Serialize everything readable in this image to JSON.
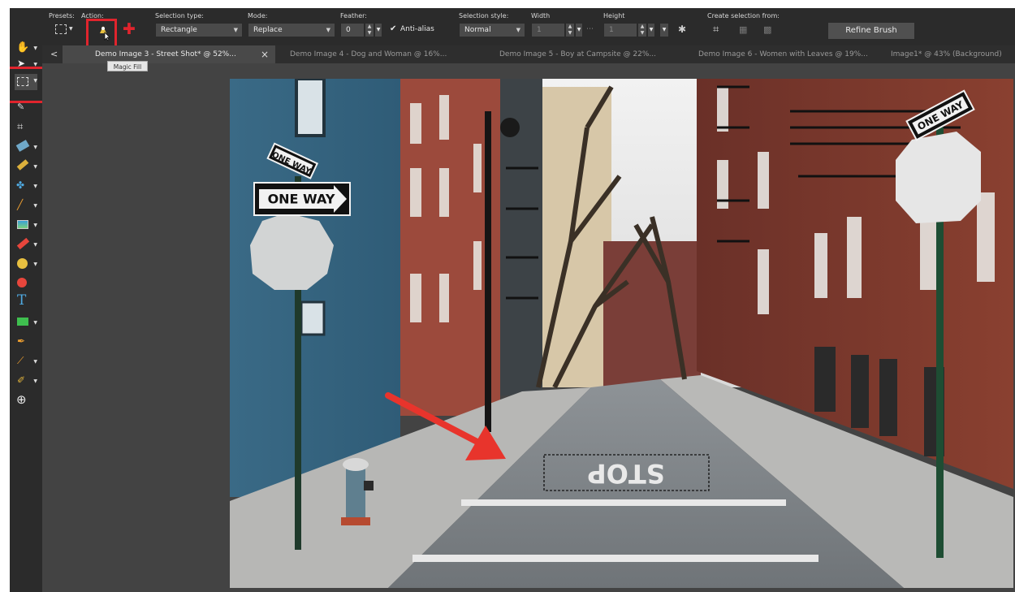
{
  "toolbar": {
    "presets_label": "Presets:",
    "action_label": "Action:",
    "selection_type_label": "Selection type:",
    "selection_type_value": "Rectangle",
    "mode_label": "Mode:",
    "mode_value": "Replace",
    "feather_label": "Feather:",
    "feather_value": "0",
    "antialias_label": "Anti-alias",
    "antialias_checked": true,
    "selection_style_label": "Selection style:",
    "selection_style_value": "Normal",
    "width_label": "Width",
    "width_value": "1",
    "height_label": "Height",
    "height_value": "1",
    "create_selection_label": "Create selection from:",
    "refine_brush_label": "Refine Brush"
  },
  "tooltip": "Magic Fill",
  "tabs": [
    {
      "label": "Demo Image 3 - Street Shot* @  52%...",
      "active": true
    },
    {
      "label": "Demo Image 4 - Dog and Woman @  16%...",
      "active": false
    },
    {
      "label": "Demo Image 5 - Boy at Campsite @  22%...",
      "active": false
    },
    {
      "label": "Demo Image 6 - Women with Leaves @  19%...",
      "active": false
    },
    {
      "label": "Image1* @  43% (Background)",
      "active": false
    }
  ],
  "tab_close": "×",
  "tab_scroll_left": "<",
  "photo": {
    "sign_left_small": "ONE WAY",
    "sign_left_big": "ONE WAY",
    "sign_right": "ONE WAY",
    "road_text": "STOP"
  },
  "colors": {
    "highlight": "#e0242d",
    "ui_dark": "#2b2b2b",
    "canvas_bg": "#434343"
  }
}
